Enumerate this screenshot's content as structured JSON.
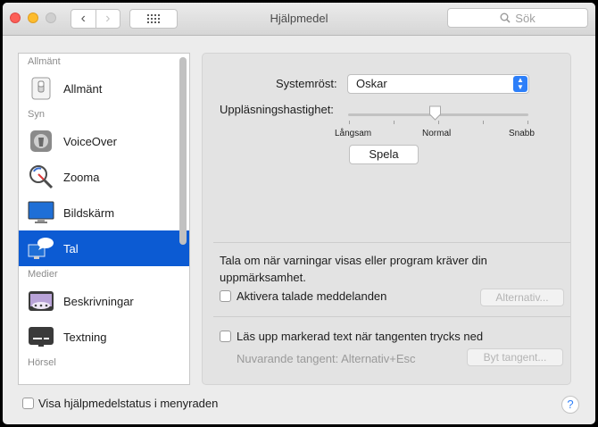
{
  "window": {
    "title": "Hjälpmedel"
  },
  "toolbar": {
    "search_placeholder": "Sök"
  },
  "sidebar": {
    "items": [
      {
        "type": "section",
        "label": "Allmänt"
      },
      {
        "type": "item",
        "label": "Allmänt",
        "icon": "switch-icon"
      },
      {
        "type": "section",
        "label": "Syn"
      },
      {
        "type": "item",
        "label": "VoiceOver",
        "icon": "voiceover-icon"
      },
      {
        "type": "item",
        "label": "Zooma",
        "icon": "magnifier-icon"
      },
      {
        "type": "item",
        "label": "Bildskärm",
        "icon": "display-icon"
      },
      {
        "type": "item",
        "label": "Tal",
        "icon": "speech-icon",
        "selected": true
      },
      {
        "type": "section",
        "label": "Medier"
      },
      {
        "type": "item",
        "label": "Beskrivningar",
        "icon": "descriptions-icon"
      },
      {
        "type": "item",
        "label": "Textning",
        "icon": "captions-icon"
      },
      {
        "type": "section",
        "label": "Hörsel"
      }
    ]
  },
  "speech": {
    "voice_label": "Systemröst:",
    "voice_value": "Oskar",
    "rate_label": "Uppläsningshastighet:",
    "rate_min": "Långsam",
    "rate_mid": "Normal",
    "rate_max": "Snabb",
    "rate_position": 0.5,
    "play_button": "Spela",
    "alerts_text": "Tala om när varningar visas eller program kräver din uppmärksamhet.",
    "announce_checkbox": "Aktivera talade meddelanden",
    "announce_checked": false,
    "options_button": "Alternativ...",
    "readselect_checkbox": "Läs upp markerad text när tangenten trycks ned",
    "readselect_checked": false,
    "current_key": "Nuvarande tangent: Alternativ+Esc",
    "change_key_button": "Byt tangent..."
  },
  "footer": {
    "menu_status_checkbox": "Visa hjälpmedelstatus i menyraden",
    "menu_status_checked": false,
    "help_label": "?"
  },
  "colors": {
    "selection": "#0c5bd3",
    "accent": "#2d7ff9"
  }
}
